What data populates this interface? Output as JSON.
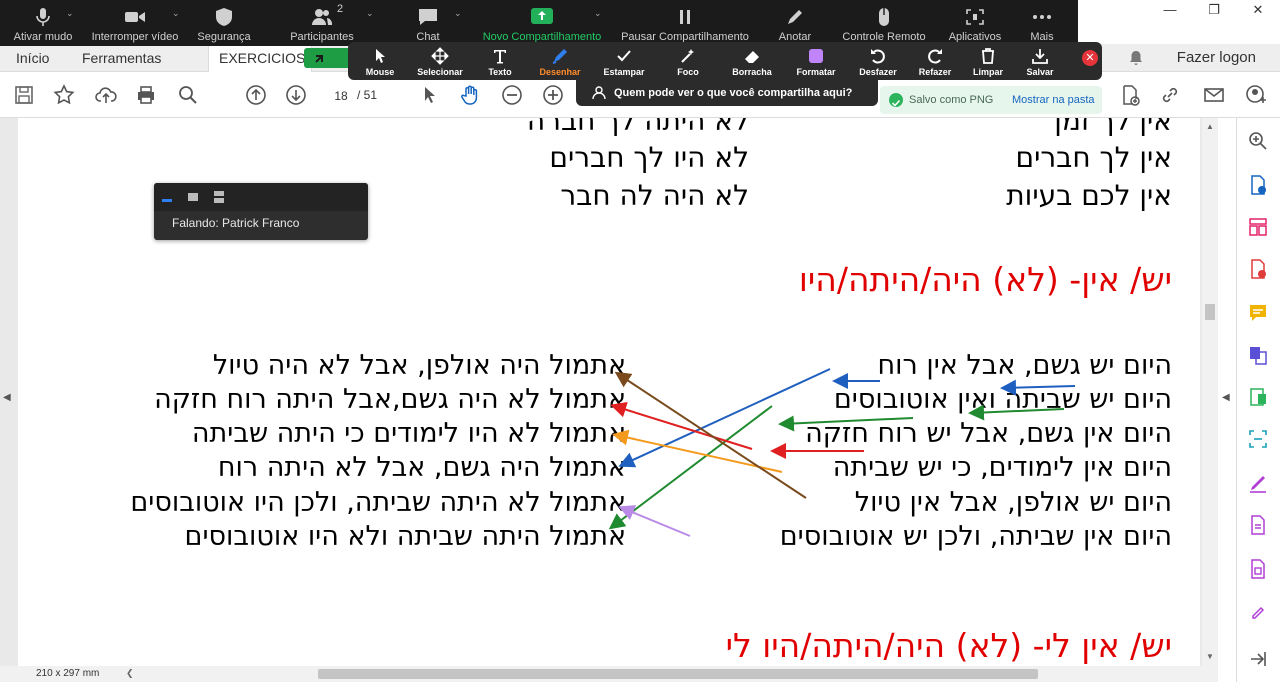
{
  "acrobat": {
    "tabs": [
      {
        "label": "Início"
      },
      {
        "label": "Ferramentas"
      },
      {
        "label": "EXERCICIOS PA"
      }
    ],
    "login": "Fazer logon",
    "page_current": "18",
    "page_total": "/ 51",
    "page_size": "210 x 297 mm"
  },
  "zoom_bar": {
    "items": [
      {
        "label": "Ativar mudo",
        "icon": "microphone-icon"
      },
      {
        "label": "Interromper vídeo",
        "icon": "video-camera-icon"
      },
      {
        "label": "Segurança",
        "icon": "shield-icon"
      },
      {
        "label": "Participantes",
        "icon": "participants-icon"
      },
      {
        "label": "Chat",
        "icon": "chat-icon"
      },
      {
        "label": "Novo Compartilhamento",
        "icon": "share-screen-icon"
      },
      {
        "label": "Pausar Compartilhamento",
        "icon": "pause-icon"
      },
      {
        "label": "Anotar",
        "icon": "pen-icon"
      },
      {
        "label": "Controle Remoto",
        "icon": "mouse-icon"
      },
      {
        "label": "Aplicativos",
        "icon": "apps-icon"
      },
      {
        "label": "Mais",
        "icon": "more-icon"
      }
    ],
    "participants_count": "2"
  },
  "annotation_bar": {
    "tools": [
      {
        "label": "Mouse"
      },
      {
        "label": "Selecionar"
      },
      {
        "label": "Texto"
      },
      {
        "label": "Desenhar"
      },
      {
        "label": "Estampar"
      },
      {
        "label": "Foco"
      },
      {
        "label": "Borracha"
      },
      {
        "label": "Formatar"
      },
      {
        "label": "Desfazer"
      },
      {
        "label": "Refazer"
      },
      {
        "label": "Limpar"
      },
      {
        "label": "Salvar"
      }
    ],
    "who_can_see": "Quem pode ver o que você compartilha aqui?"
  },
  "saved_toast": {
    "text": "Salvo como PNG",
    "link": "Mostrar na pasta"
  },
  "speaker": {
    "text": "Falando: Patrick Franco"
  },
  "document": {
    "top_right": [
      "אין לך זמן",
      "אין לך חברים",
      "אין לכם בעיות"
    ],
    "top_left": [
      "לא היתה לך חברה",
      "לא היו לך חברים",
      "לא היה לה חבר"
    ],
    "heading1": "יש/ אין- (לא) היה/היתה/היו",
    "right_col": [
      "היום יש גשם, אבל אין רוח",
      "היום יש שביתה ואין אוטובוסים",
      "היום אין גשם, אבל יש רוח חזקה",
      "היום אין לימודים, כי יש שביתה",
      "היום יש אולפן, אבל אין טיול",
      "היום אין שביתה, ולכן יש אוטובוסים"
    ],
    "left_col": [
      "אתמול היה אולפן, אבל לא היה טיול",
      "אתמול לא היה גשם,אבל היתה רוח חזקה",
      "אתמול לא היו לימודים כי היתה שביתה",
      "אתמול היה גשם, אבל לא היתה רוח",
      "אתמול לא היתה שביתה, ולכן היו  אוטובוסים",
      "אתמול היתה שביתה ולא היו אוטובוסים"
    ],
    "heading2": "יש/ אין לי- (לא) היה/היתה/היו לי"
  },
  "colors": {
    "zoom_bg": "#1b1b1b",
    "zoom_green": "#22cc66",
    "heading_red": "#e00000",
    "active_tool": "#ff8c2a",
    "arrow_blue": "#1f5fbf",
    "arrow_green": "#1f8a2f",
    "arrow_red": "#e02020",
    "arrow_orange": "#f39a1c",
    "arrow_brown": "#7a4a1c",
    "arrow_purple": "#b98be6"
  }
}
